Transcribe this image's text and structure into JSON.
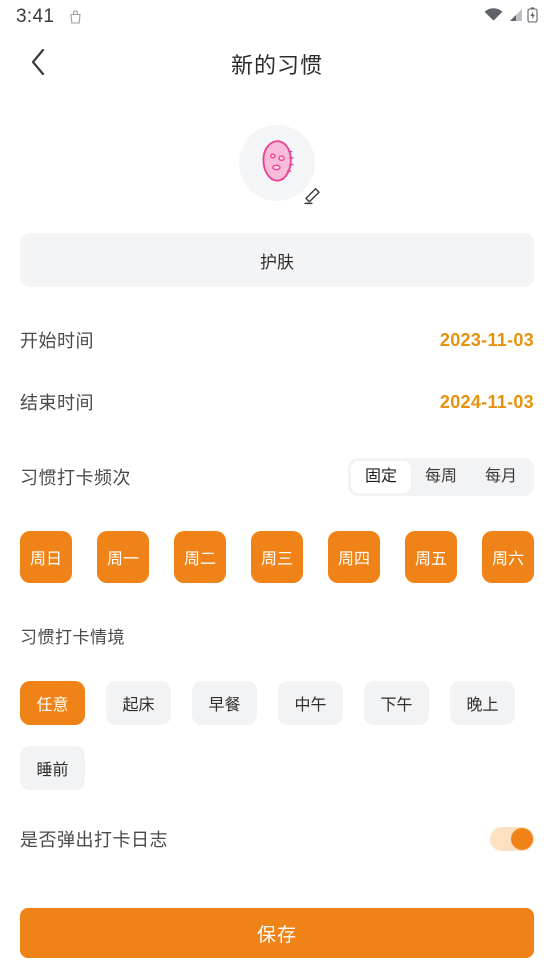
{
  "status_bar": {
    "time": "3:41",
    "left_icon": "shopping-bag-icon",
    "right_icons": [
      "wifi-icon",
      "cellular-signal-icon",
      "battery-charging-icon"
    ]
  },
  "nav": {
    "back_icon": "chevron-left-icon",
    "title": "新的习惯"
  },
  "avatar": {
    "icon": "face-mask-icon",
    "edit_icon": "pencil-icon"
  },
  "name_field": {
    "value": "护肤",
    "placeholder": "请输入习惯名称"
  },
  "start_date": {
    "label": "开始时间",
    "value": "2023-11-03"
  },
  "end_date": {
    "label": "结束时间",
    "value": "2024-11-03"
  },
  "frequency": {
    "label": "习惯打卡频次",
    "options": [
      {
        "label": "固定",
        "selected": true
      },
      {
        "label": "每周",
        "selected": false
      },
      {
        "label": "每月",
        "selected": false
      }
    ]
  },
  "weekdays": [
    {
      "label": "周日",
      "selected": true
    },
    {
      "label": "周一",
      "selected": true
    },
    {
      "label": "周二",
      "selected": true
    },
    {
      "label": "周三",
      "selected": true
    },
    {
      "label": "周四",
      "selected": true
    },
    {
      "label": "周五",
      "selected": true
    },
    {
      "label": "周六",
      "selected": true
    }
  ],
  "context": {
    "label": "习惯打卡情境",
    "options": [
      {
        "label": "任意",
        "selected": true
      },
      {
        "label": "起床",
        "selected": false
      },
      {
        "label": "早餐",
        "selected": false
      },
      {
        "label": "中午",
        "selected": false
      },
      {
        "label": "下午",
        "selected": false
      },
      {
        "label": "晚上",
        "selected": false
      },
      {
        "label": "睡前",
        "selected": false
      }
    ]
  },
  "log_toggle": {
    "label": "是否弹出打卡日志",
    "on": true
  },
  "save": {
    "label": "保存"
  },
  "colors": {
    "accent": "#ef8317",
    "date_text": "#e8920c",
    "chip_bg": "#f2f3f5",
    "field_bg": "#f2f4f6",
    "avatar_bg": "#f3f5f6",
    "mask_fill": "#f7b6d2",
    "mask_stroke": "#e8459a"
  }
}
